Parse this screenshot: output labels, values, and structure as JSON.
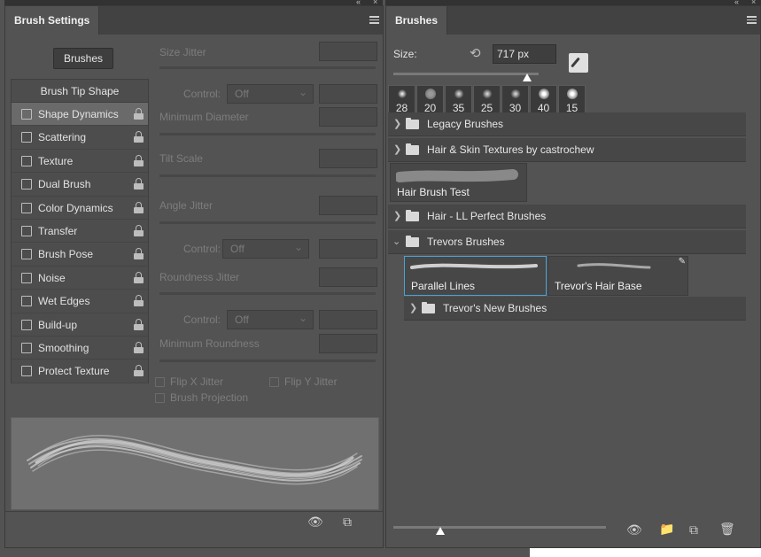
{
  "left_panel": {
    "tab_title": "Brush Settings",
    "brushes_button": "Brushes",
    "tip_header": "Brush Tip Shape",
    "items": [
      {
        "label": "Shape Dynamics",
        "selected": true
      },
      {
        "label": "Scattering"
      },
      {
        "label": "Texture"
      },
      {
        "label": "Dual Brush"
      },
      {
        "label": "Color Dynamics"
      },
      {
        "label": "Transfer"
      },
      {
        "label": "Brush Pose"
      },
      {
        "label": "Noise"
      },
      {
        "label": "Wet Edges"
      },
      {
        "label": "Build-up"
      },
      {
        "label": "Smoothing"
      },
      {
        "label": "Protect Texture"
      }
    ],
    "controls": {
      "size_jitter": "Size Jitter",
      "control_label": "Control:",
      "control_value": "Off",
      "minimum_diameter": "Minimum Diameter",
      "tilt_scale": "Tilt Scale",
      "angle_jitter": "Angle Jitter",
      "roundness_jitter": "Roundness Jitter",
      "minimum_roundness": "Minimum Roundness",
      "flip_x": "Flip X Jitter",
      "flip_y": "Flip Y Jitter",
      "brush_projection": "Brush Projection"
    }
  },
  "right_panel": {
    "tab_title": "Brushes",
    "size_label": "Size:",
    "size_value": "717 px",
    "size_fraction": 0.92,
    "presets": [
      {
        "num": "28"
      },
      {
        "num": "20"
      },
      {
        "num": "35"
      },
      {
        "num": "25"
      },
      {
        "num": "30"
      },
      {
        "num": "40"
      },
      {
        "num": "15"
      }
    ],
    "groups": {
      "legacy": "Legacy Brushes",
      "hair_skin": "Hair & Skin Textures by castrochew",
      "hair_brush_test": "Hair Brush Test",
      "hair_ll": "Hair - LL Perfect Brushes",
      "trevors": "Trevors Brushes",
      "parallel_lines": "Parallel Lines",
      "trevors_hair_base": "Trevor's Hair Base",
      "trevors_new": "Trevor's New Brushes"
    },
    "thumb_size_fraction": 0.22
  },
  "icons": {
    "collapse": "collapse-arrows-icon",
    "menu": "panel-menu-icon",
    "lock": "lock-icon",
    "folder": "folder-icon",
    "eye": "toggle-preview-icon",
    "new": "new-brush-icon",
    "delete": "trash-icon"
  },
  "colors": {
    "panel_bg": "#535353",
    "selection": "#4aa2d6"
  }
}
